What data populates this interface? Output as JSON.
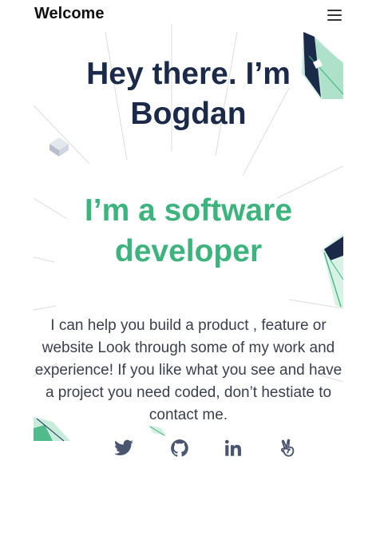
{
  "header": {
    "brand": "Welcome",
    "menu_icon": "hamburger-menu-icon"
  },
  "hero": {
    "headline": "Hey there. I’m Bogdan",
    "subheadline": "I’m a software developer",
    "intro": "I can help you build a product , feature or website Look through some of my work and experience! If you like what you see and have a project you need coded, don’t hestiate to contact me."
  },
  "social": [
    {
      "name": "twitter",
      "icon": "twitter-icon"
    },
    {
      "name": "github",
      "icon": "github-icon"
    },
    {
      "name": "linkedin",
      "icon": "linkedin-icon"
    },
    {
      "name": "angellist",
      "icon": "angellist-icon"
    }
  ],
  "colors": {
    "headline": "#1b2a48",
    "accent": "#3db37e",
    "body_text": "#3a3f4e",
    "icon": "#4a5670",
    "background": "#ffffff"
  }
}
